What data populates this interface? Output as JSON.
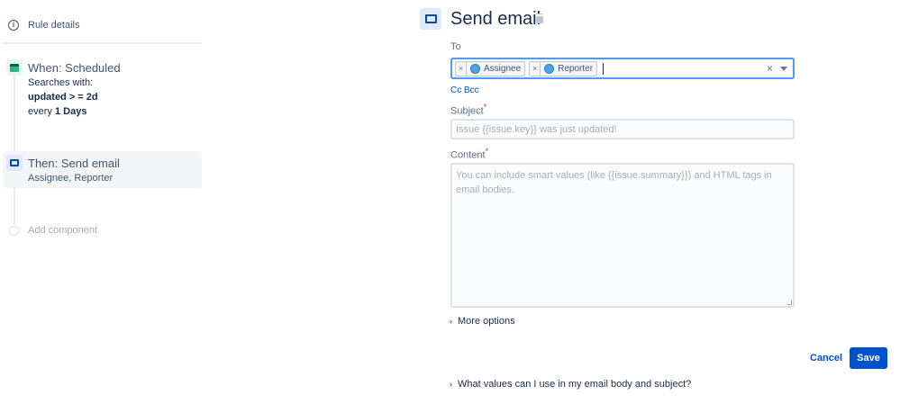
{
  "sidebar": {
    "rule_details": "Rule details",
    "trigger": {
      "title": "When: Scheduled",
      "line1": "Searches with:",
      "query": "updated > = 2d",
      "every_prefix": "every ",
      "every_value": "1 Days"
    },
    "action": {
      "title": "Then: Send email",
      "subtitle": "Assignee, Reporter"
    },
    "add_component": "Add component"
  },
  "main": {
    "title": "Send email",
    "to_label": "To",
    "recipients": [
      "Assignee",
      "Reporter"
    ],
    "cc_bcc": "Cc Bcc",
    "subject_label": "Subject",
    "subject_placeholder": "Issue {{issue.key}} was just updated!",
    "content_label": "Content",
    "content_placeholder": "You can include smart values (like {{issue.summary}}) and HTML tags in email bodies.",
    "required_mark": "*",
    "more_options": "More options",
    "cancel": "Cancel",
    "save": "Save",
    "help": "What values can I use in my email body and subject?"
  },
  "colors": {
    "primary": "#0052cc",
    "focus": "#4c9aff",
    "trigger_bg": "#e3fcef",
    "action_bg": "#deebff"
  }
}
